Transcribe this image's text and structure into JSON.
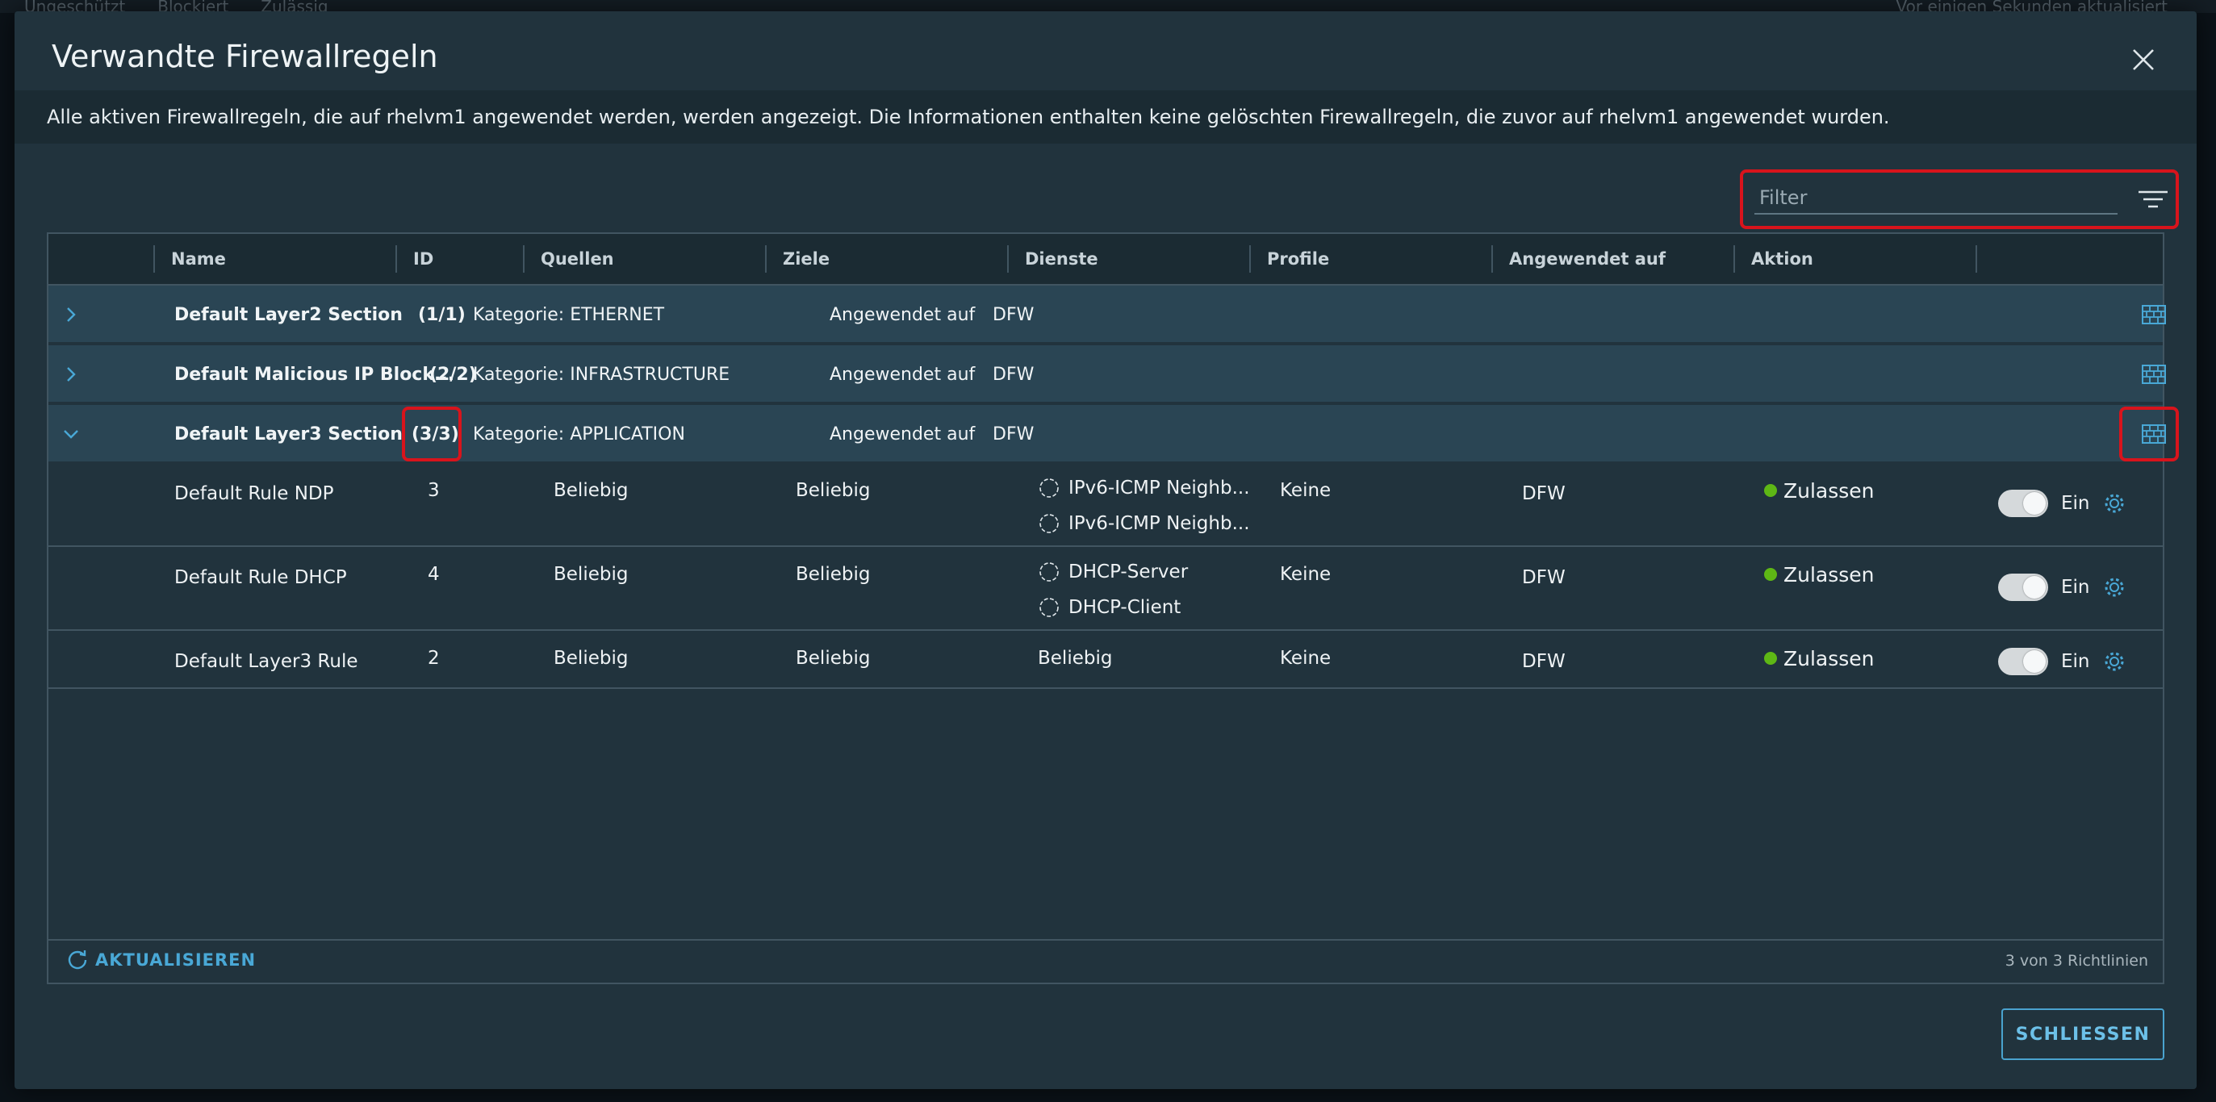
{
  "background": {
    "legend_items": [
      "Ungeschützt",
      "Blockiert",
      "Zulässig"
    ],
    "status": "Vor einigen Sekunden aktualisiert"
  },
  "modal": {
    "title": "Verwandte Firewallregeln",
    "info": "Alle aktiven Firewallregeln, die auf rhelvm1 angewendet werden, werden angezeigt. Die Informationen enthalten keine gelöschten Firewallregeln, die zuvor auf rhelvm1 angewendet wurden.",
    "filter_placeholder": "Filter",
    "close_button": "SCHLIESSEN",
    "accent_color": "#49a8d6",
    "highlight_color": "#d8141c",
    "allow_color": "#5eb715"
  },
  "grid": {
    "columns": [
      "Name",
      "ID",
      "Quellen",
      "Ziele",
      "Dienste",
      "Profile",
      "Angewendet auf",
      "Aktion"
    ],
    "sections": [
      {
        "name": "Default Layer2 Section",
        "count": "(1/1)",
        "category": "Kategorie: ETHERNET",
        "applied_label": "Angewendet auf",
        "applied_value": "DFW",
        "expanded": false
      },
      {
        "name": "Default Malicious IP Block...",
        "count": "(2/2)",
        "category": "Kategorie: INFRASTRUCTURE",
        "applied_label": "Angewendet auf",
        "applied_value": "DFW",
        "expanded": false
      },
      {
        "name": "Default Layer3 Section",
        "count": "(3/3)",
        "category": "Kategorie: APPLICATION",
        "applied_label": "Angewendet auf",
        "applied_value": "DFW",
        "expanded": true
      }
    ],
    "rules": [
      {
        "name": "Default Rule NDP",
        "id": "3",
        "sources": "Beliebig",
        "destinations": "Beliebig",
        "services": [
          "IPv6-ICMP Neighb...",
          "IPv6-ICMP Neighb..."
        ],
        "profiles": "Keine",
        "applied_to": "DFW",
        "action": "Zulassen",
        "toggle_label": "Ein"
      },
      {
        "name": "Default Rule DHCP",
        "id": "4",
        "sources": "Beliebig",
        "destinations": "Beliebig",
        "services": [
          "DHCP-Server",
          "DHCP-Client"
        ],
        "profiles": "Keine",
        "applied_to": "DFW",
        "action": "Zulassen",
        "toggle_label": "Ein"
      },
      {
        "name": "Default Layer3 Rule",
        "id": "2",
        "sources": "Beliebig",
        "destinations": "Beliebig",
        "services_text": "Beliebig",
        "profiles": "Keine",
        "applied_to": "DFW",
        "action": "Zulassen",
        "toggle_label": "Ein"
      }
    ],
    "refresh_label": "AKTUALISIEREN",
    "footer_count": "3 von 3 Richtlinien"
  }
}
